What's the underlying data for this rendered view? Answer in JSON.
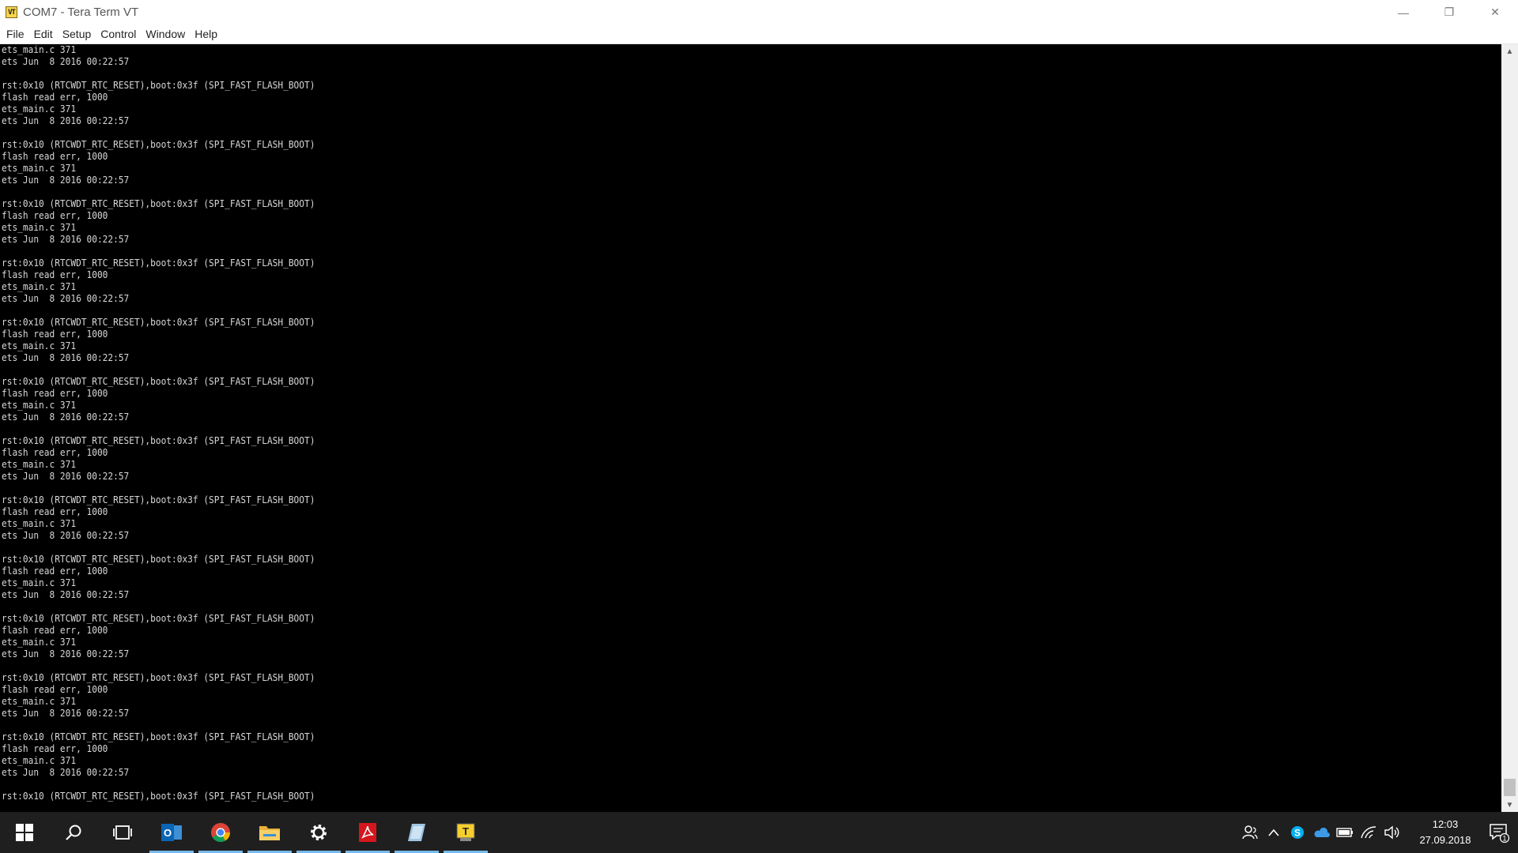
{
  "window": {
    "title": "COM7 - Tera Term VT",
    "app_icon_text": "VT",
    "controls": {
      "minimize": "—",
      "restore": "❐",
      "close": "✕"
    }
  },
  "menu": [
    "File",
    "Edit",
    "Setup",
    "Control",
    "Window",
    "Help"
  ],
  "terminal": {
    "lines": [
      "ets_main.c 371",
      "ets Jun  8 2016 00:22:57",
      "",
      "rst:0x10 (RTCWDT_RTC_RESET),boot:0x3f (SPI_FAST_FLASH_BOOT)",
      "flash read err, 1000",
      "ets_main.c 371",
      "ets Jun  8 2016 00:22:57",
      "",
      "rst:0x10 (RTCWDT_RTC_RESET),boot:0x3f (SPI_FAST_FLASH_BOOT)",
      "flash read err, 1000",
      "ets_main.c 371",
      "ets Jun  8 2016 00:22:57",
      "",
      "rst:0x10 (RTCWDT_RTC_RESET),boot:0x3f (SPI_FAST_FLASH_BOOT)",
      "flash read err, 1000",
      "ets_main.c 371",
      "ets Jun  8 2016 00:22:57",
      "",
      "rst:0x10 (RTCWDT_RTC_RESET),boot:0x3f (SPI_FAST_FLASH_BOOT)",
      "flash read err, 1000",
      "ets_main.c 371",
      "ets Jun  8 2016 00:22:57",
      "",
      "rst:0x10 (RTCWDT_RTC_RESET),boot:0x3f (SPI_FAST_FLASH_BOOT)",
      "flash read err, 1000",
      "ets_main.c 371",
      "ets Jun  8 2016 00:22:57",
      "",
      "rst:0x10 (RTCWDT_RTC_RESET),boot:0x3f (SPI_FAST_FLASH_BOOT)",
      "flash read err, 1000",
      "ets_main.c 371",
      "ets Jun  8 2016 00:22:57",
      "",
      "rst:0x10 (RTCWDT_RTC_RESET),boot:0x3f (SPI_FAST_FLASH_BOOT)",
      "flash read err, 1000",
      "ets_main.c 371",
      "ets Jun  8 2016 00:22:57",
      "",
      "rst:0x10 (RTCWDT_RTC_RESET),boot:0x3f (SPI_FAST_FLASH_BOOT)",
      "flash read err, 1000",
      "ets_main.c 371",
      "ets Jun  8 2016 00:22:57",
      "",
      "rst:0x10 (RTCWDT_RTC_RESET),boot:0x3f (SPI_FAST_FLASH_BOOT)",
      "flash read err, 1000",
      "ets_main.c 371",
      "ets Jun  8 2016 00:22:57",
      "",
      "rst:0x10 (RTCWDT_RTC_RESET),boot:0x3f (SPI_FAST_FLASH_BOOT)",
      "flash read err, 1000",
      "ets_main.c 371",
      "ets Jun  8 2016 00:22:57",
      "",
      "rst:0x10 (RTCWDT_RTC_RESET),boot:0x3f (SPI_FAST_FLASH_BOOT)",
      "flash read err, 1000",
      "ets_main.c 371",
      "ets Jun  8 2016 00:22:57",
      "",
      "rst:0x10 (RTCWDT_RTC_RESET),boot:0x3f (SPI_FAST_FLASH_BOOT)",
      "flash read err, 1000",
      "ets_main.c 371",
      "ets Jun  8 2016 00:22:57",
      "",
      "rst:0x10 (RTCWDT_RTC_RESET),boot:0x3f (SPI_FAST_FLASH_BOOT)"
    ]
  },
  "scrollbar": {
    "up_arrow": "▲",
    "down_arrow": "▼",
    "position_fraction": 0.98
  },
  "taskbar": {
    "apps": [
      {
        "name": "start",
        "active": false
      },
      {
        "name": "search",
        "active": false
      },
      {
        "name": "task-view",
        "active": false
      },
      {
        "name": "outlook",
        "active": true,
        "text": "O"
      },
      {
        "name": "chrome",
        "active": true
      },
      {
        "name": "file-explorer",
        "active": true
      },
      {
        "name": "settings",
        "active": true
      },
      {
        "name": "acrobat",
        "active": true
      },
      {
        "name": "notepad-app",
        "active": true
      },
      {
        "name": "tera-term",
        "active": true,
        "text": "T"
      }
    ],
    "tray_icons": [
      "people-icon",
      "chevron-up-icon",
      "skype-icon",
      "onedrive-icon",
      "battery-icon",
      "wifi-icon",
      "volume-icon"
    ],
    "clock_time": "12:03",
    "clock_date": "27.09.2018",
    "notification_count": "1"
  },
  "colors": {
    "terminal_bg": "#000000",
    "terminal_fg": "#d8d8d8",
    "taskbar_bg": "#1f1f1f",
    "taskbar_active": "#76b9ed"
  }
}
